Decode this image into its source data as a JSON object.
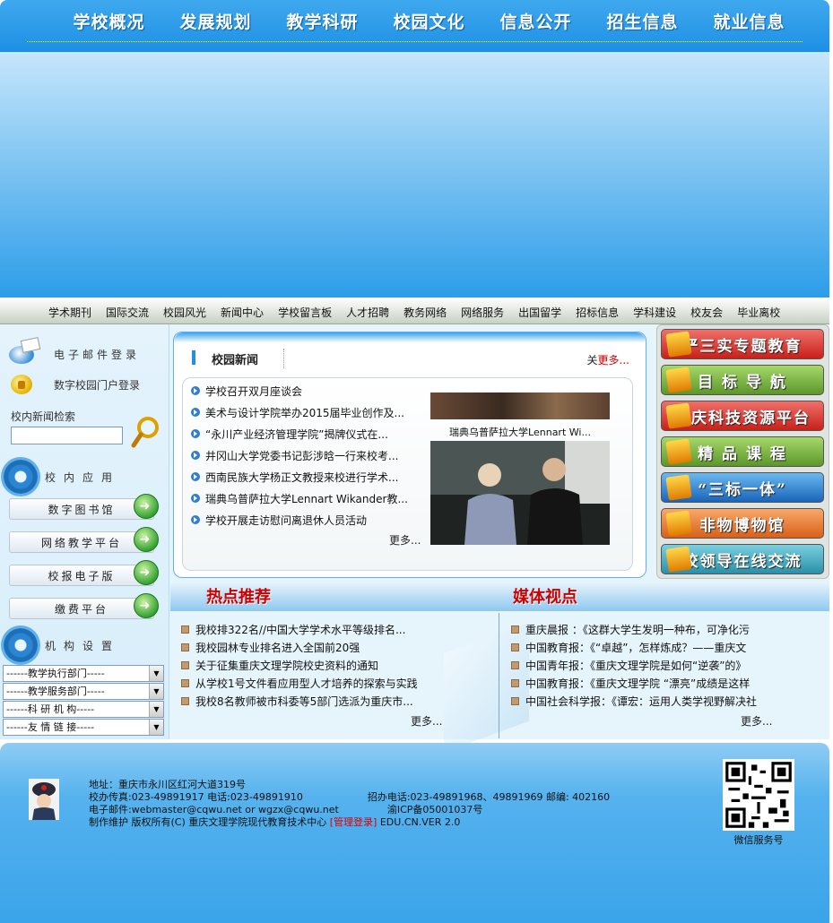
{
  "topnav": {
    "items": [
      "学校概况",
      "发展规划",
      "教学科研",
      "校园文化",
      "信息公开",
      "招生信息",
      "就业信息"
    ]
  },
  "subnav": {
    "items": [
      "学术期刊",
      "国际交流",
      "校园风光",
      "新闻中心",
      "学校留言板",
      "人才招聘",
      "教务网络",
      "网络服务",
      "出国留学",
      "招标信息",
      "学科建设",
      "校友会",
      "毕业离校"
    ]
  },
  "left": {
    "email_login": "电子邮件登录",
    "portal_login": "数字校园门户登录",
    "search_label": "校内新闻检索",
    "apps_title": "校内应用",
    "apps": [
      "数字图书馆",
      "网络教学平台",
      "校报电子版",
      "缴费平台"
    ],
    "org_title": "机构设置",
    "selects": [
      "------教学执行部门-----",
      "------教学服务部门-----",
      "------科 研 机 构-----",
      "------友 情 链 接-----"
    ]
  },
  "news": {
    "title": "校园新闻",
    "more_prefix": "关",
    "more_link": "更多...",
    "items": [
      "学校召开双月座谈会",
      "美术与设计学院举办2015届毕业创作及...",
      "“永川产业经济管理学院”揭牌仪式在...",
      "井冈山大学党委书记彭涉晗一行来校考...",
      "西南民族大学杨正文教授来校进行学术...",
      "瑞典乌普萨拉大学Lennart Wikander教...",
      "学校开展走访慰问离退休人员活动"
    ],
    "bottom_more": "更多...",
    "photo_caption": "瑞典乌普萨拉大学Lennart Wi..."
  },
  "promo": {
    "items": [
      "严三实专题教育",
      "目 标 导 航",
      "重庆科技资源平台",
      "精 品 课 程",
      "“三标一体”",
      "非物博物馆",
      "校领导在线交流"
    ],
    "colors": [
      "#d8342c",
      "#6fa83a",
      "#d8342c",
      "#6fa83a",
      "#2a7fd0",
      "#e8772a",
      "#3aa0b8"
    ]
  },
  "hot": {
    "title": "热点推荐",
    "items": [
      "我校排322名//中国大学学术水平等级排名...",
      "我校园林专业排名进入全国前20强",
      "关于征集重庆文理学院校史资料的通知",
      "从学校1号文件看应用型人才培养的探索与实践",
      "我校8名教师被市科委等5部门选派为重庆市..."
    ],
    "more": "更多..."
  },
  "media": {
    "title": "媒体视点",
    "items": [
      "重庆晨报 ：《这群大学生发明一种布，可净化污",
      "中国教育报：《“卓越”，怎样炼成？——重庆文",
      "中国青年报：《重庆文理学院是如何“逆袭”的》",
      "中国教育报：《重庆文理学院 “漂亮”成绩是这样",
      "中国社会科学报：《谭宏：运用人类学视野解决社"
    ],
    "more": "更多..."
  },
  "footer": {
    "address": "地址：重庆市永川区红河大道319号",
    "office": "校办传真:023-49891917 电话:023-49891910",
    "admissions": "招办电话:023-49891968、49891969 邮编: 402160",
    "email": "电子邮件:webmaster@cqwu.net or wgzx@cqwu.net",
    "icp": "渝ICP备05001037号",
    "maintainer": "制作维护 版权所有(C)  重庆文理学院现代教育技术中心",
    "admin_login": "[管理登录]",
    "version": "EDU.CN.VER 2.0",
    "qr_label": "微信服务号"
  }
}
